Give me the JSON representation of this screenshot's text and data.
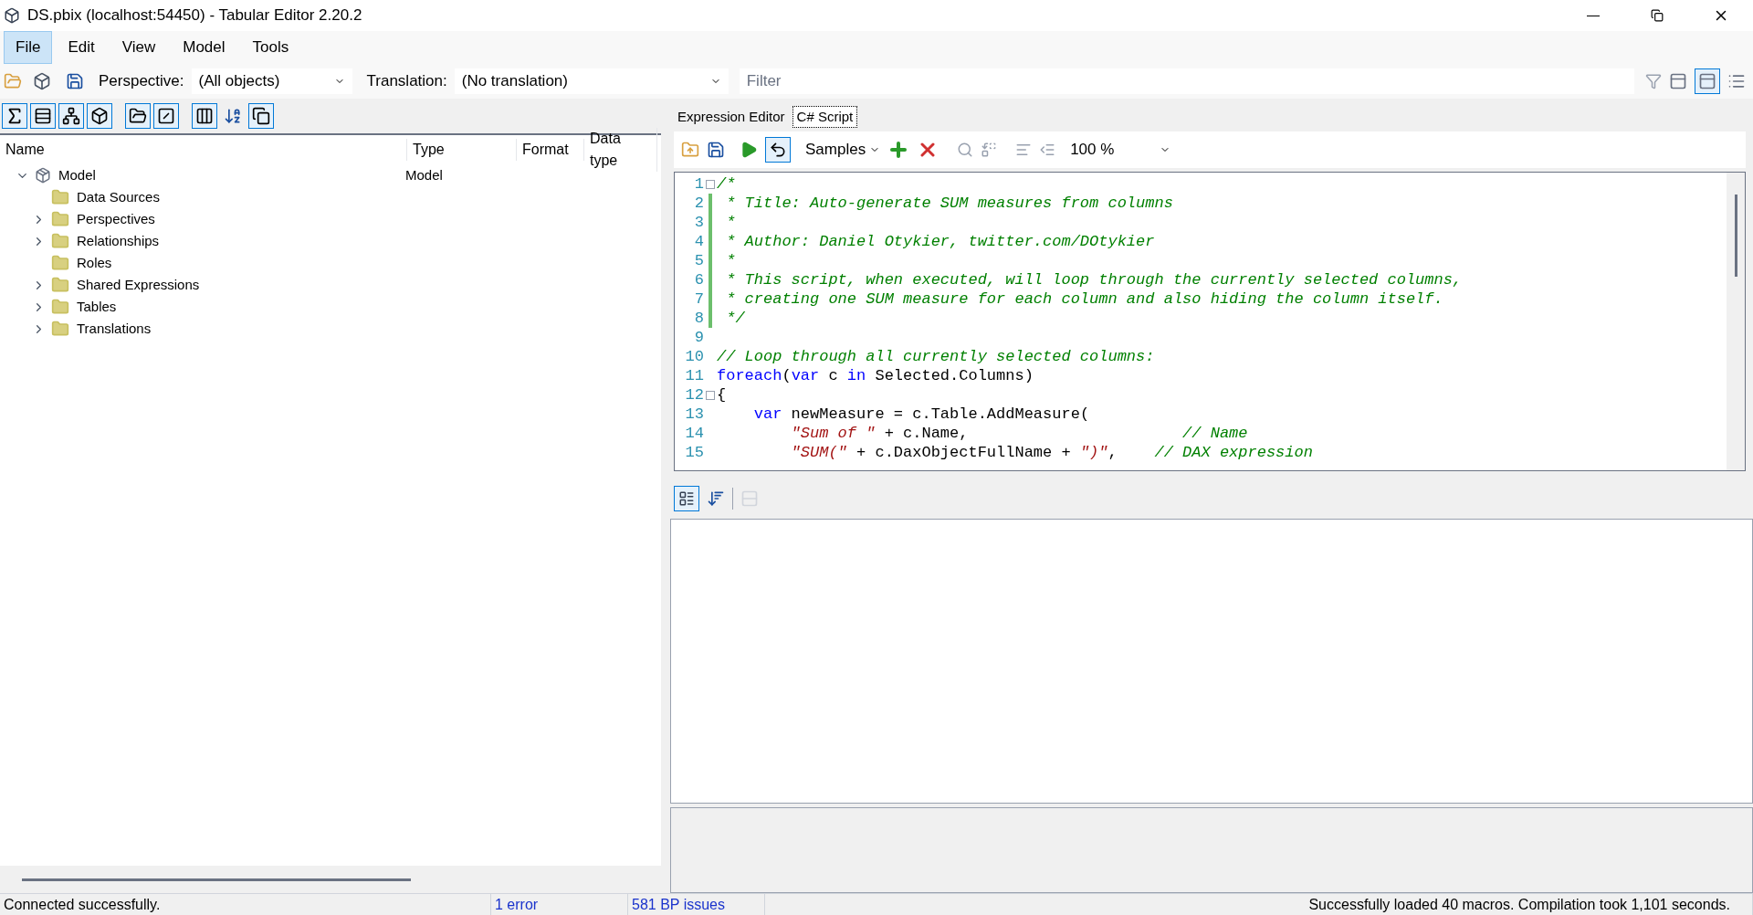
{
  "window": {
    "title": "DS.pbix (localhost:54450) - Tabular Editor 2.20.2"
  },
  "menu": [
    {
      "label": "File",
      "selected": true
    },
    {
      "label": "Edit",
      "selected": false
    },
    {
      "label": "View",
      "selected": false
    },
    {
      "label": "Model",
      "selected": false
    },
    {
      "label": "Tools",
      "selected": false
    }
  ],
  "toolbar": {
    "perspective_label": "Perspective:",
    "perspective_value": "(All objects)",
    "translation_label": "Translation:",
    "translation_value": "(No translation)",
    "filter_placeholder": "Filter"
  },
  "tree": {
    "columns": [
      "Name",
      "Type",
      "Format",
      "Data type"
    ],
    "items": [
      {
        "name": "Model",
        "type": "Model",
        "kind": "model",
        "expanded": true,
        "children": [
          {
            "name": "Data Sources",
            "kind": "folder"
          },
          {
            "name": "Perspectives",
            "kind": "folder",
            "expanded": false
          },
          {
            "name": "Relationships",
            "kind": "folder",
            "expanded": false
          },
          {
            "name": "Roles",
            "kind": "folder"
          },
          {
            "name": "Shared Expressions",
            "kind": "folder",
            "expanded": false
          },
          {
            "name": "Tables",
            "kind": "folder",
            "expanded": false
          },
          {
            "name": "Translations",
            "kind": "folder",
            "expanded": false
          }
        ]
      }
    ]
  },
  "editor_tabs": [
    {
      "label": "Expression Editor",
      "selected": false
    },
    {
      "label": "C# Script",
      "selected": true
    }
  ],
  "script_toolbar": {
    "samples": "Samples",
    "zoom": "100 %"
  },
  "code": [
    {
      "number": "1",
      "kind": "fold",
      "segments": [
        {
          "kind": "comment",
          "text": "/*"
        }
      ]
    },
    {
      "number": "2",
      "kind": "change",
      "segments": [
        {
          "kind": "comment",
          "text": " * Title: Auto-generate SUM measures from columns"
        }
      ]
    },
    {
      "number": "3",
      "kind": "change",
      "segments": [
        {
          "kind": "comment",
          "text": " *"
        }
      ]
    },
    {
      "number": "4",
      "kind": "change",
      "segments": [
        {
          "kind": "comment",
          "text": " * Author: Daniel Otykier, twitter.com/DOtykier"
        }
      ]
    },
    {
      "number": "5",
      "kind": "change",
      "segments": [
        {
          "kind": "comment",
          "text": " *"
        }
      ]
    },
    {
      "number": "6",
      "kind": "change",
      "segments": [
        {
          "kind": "comment",
          "text": " * This script, when executed, will loop through the currently selected columns,"
        }
      ]
    },
    {
      "number": "7",
      "kind": "change",
      "segments": [
        {
          "kind": "comment",
          "text": " * creating one SUM measure for each column and also hiding the column itself."
        }
      ]
    },
    {
      "number": "8",
      "kind": "change",
      "segments": [
        {
          "kind": "comment",
          "text": " */"
        }
      ]
    },
    {
      "number": "9",
      "kind": "plain"
    },
    {
      "number": "10",
      "kind": "plain",
      "segments": [
        {
          "kind": "comment",
          "text": "// Loop through all currently selected columns:"
        }
      ]
    },
    {
      "number": "11",
      "kind": "plain",
      "segments": [
        {
          "kind": "keyword",
          "text": "foreach"
        },
        {
          "kind": "plain",
          "text": "("
        },
        {
          "kind": "keyword",
          "text": "var"
        },
        {
          "kind": "plain",
          "text": " c "
        },
        {
          "kind": "keyword",
          "text": "in"
        },
        {
          "kind": "plain",
          "text": " Selected.Columns)"
        }
      ]
    },
    {
      "number": "12",
      "kind": "fold",
      "segments": [
        {
          "kind": "plain",
          "text": "{"
        }
      ]
    },
    {
      "number": "13",
      "kind": "plain",
      "segments": [
        {
          "kind": "keyword",
          "text": "    var"
        },
        {
          "kind": "plain",
          "text": " newMeasure = c.Table.AddMeasure("
        }
      ]
    },
    {
      "number": "14",
      "kind": "plain",
      "segments": [
        {
          "kind": "string",
          "text": "        \"Sum of \""
        },
        {
          "kind": "plain",
          "text": " + c.Name,                       "
        },
        {
          "kind": "comment",
          "text": "// Name"
        }
      ]
    },
    {
      "number": "15",
      "kind": "plain",
      "segments": [
        {
          "kind": "string",
          "text": "        \"SUM(\""
        },
        {
          "kind": "plain",
          "text": " + c.DaxObjectFullName + "
        },
        {
          "kind": "string",
          "text": "\")\""
        },
        {
          "kind": "plain",
          "text": ",    "
        },
        {
          "kind": "comment",
          "text": "// DAX expression"
        }
      ]
    }
  ],
  "status_bar": [
    {
      "text": "Connected successfully.",
      "kind": "text"
    },
    {
      "text": "1 error",
      "kind": "link"
    },
    {
      "text": "581 BP issues",
      "kind": "link"
    },
    {
      "text": "Successfully loaded 40 macros. Compilation took 1,101 seconds.",
      "kind": "message"
    }
  ]
}
